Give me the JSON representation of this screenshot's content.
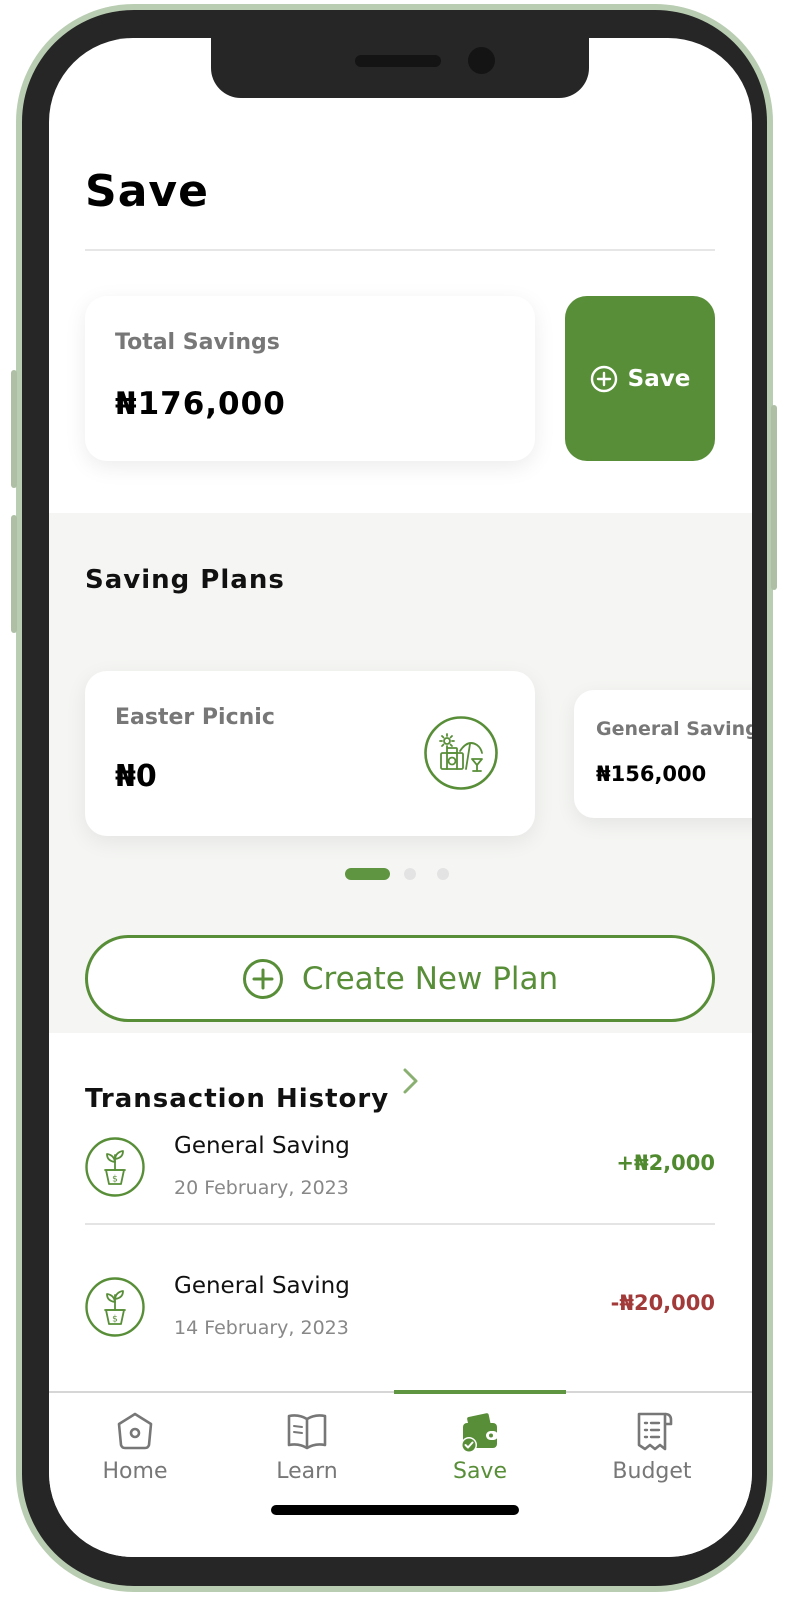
{
  "header": {
    "title": "Save"
  },
  "summary": {
    "total_label": "Total Savings",
    "total_value": "₦176,000",
    "save_button_label": "Save"
  },
  "plans": {
    "title": "Saving Plans",
    "items": [
      {
        "name": "Easter Picnic",
        "amount": "₦0",
        "icon": "picnic-icon"
      },
      {
        "name": "General Saving",
        "amount": "₦156,000"
      }
    ],
    "pagination": {
      "pages": 3,
      "active": 1
    },
    "create_label": "Create New Plan"
  },
  "transactions": {
    "title": "Transaction History",
    "items": [
      {
        "name": "General Saving",
        "date": "20 February, 2023",
        "amount": "+₦2,000",
        "type": "credit"
      },
      {
        "name": "General Saving",
        "date": "14 February, 2023",
        "amount": "-₦20,000",
        "type": "debit"
      }
    ]
  },
  "nav": {
    "items": [
      {
        "label": "Home",
        "icon": "home-icon"
      },
      {
        "label": "Learn",
        "icon": "book-icon"
      },
      {
        "label": "Save",
        "icon": "wallet-icon",
        "active": true
      },
      {
        "label": "Budget",
        "icon": "receipt-icon"
      }
    ]
  },
  "colors": {
    "accent": "#588e38",
    "credit": "#4f8a2e",
    "debit": "#a33a3a",
    "section_bg": "#f5f6f3"
  }
}
